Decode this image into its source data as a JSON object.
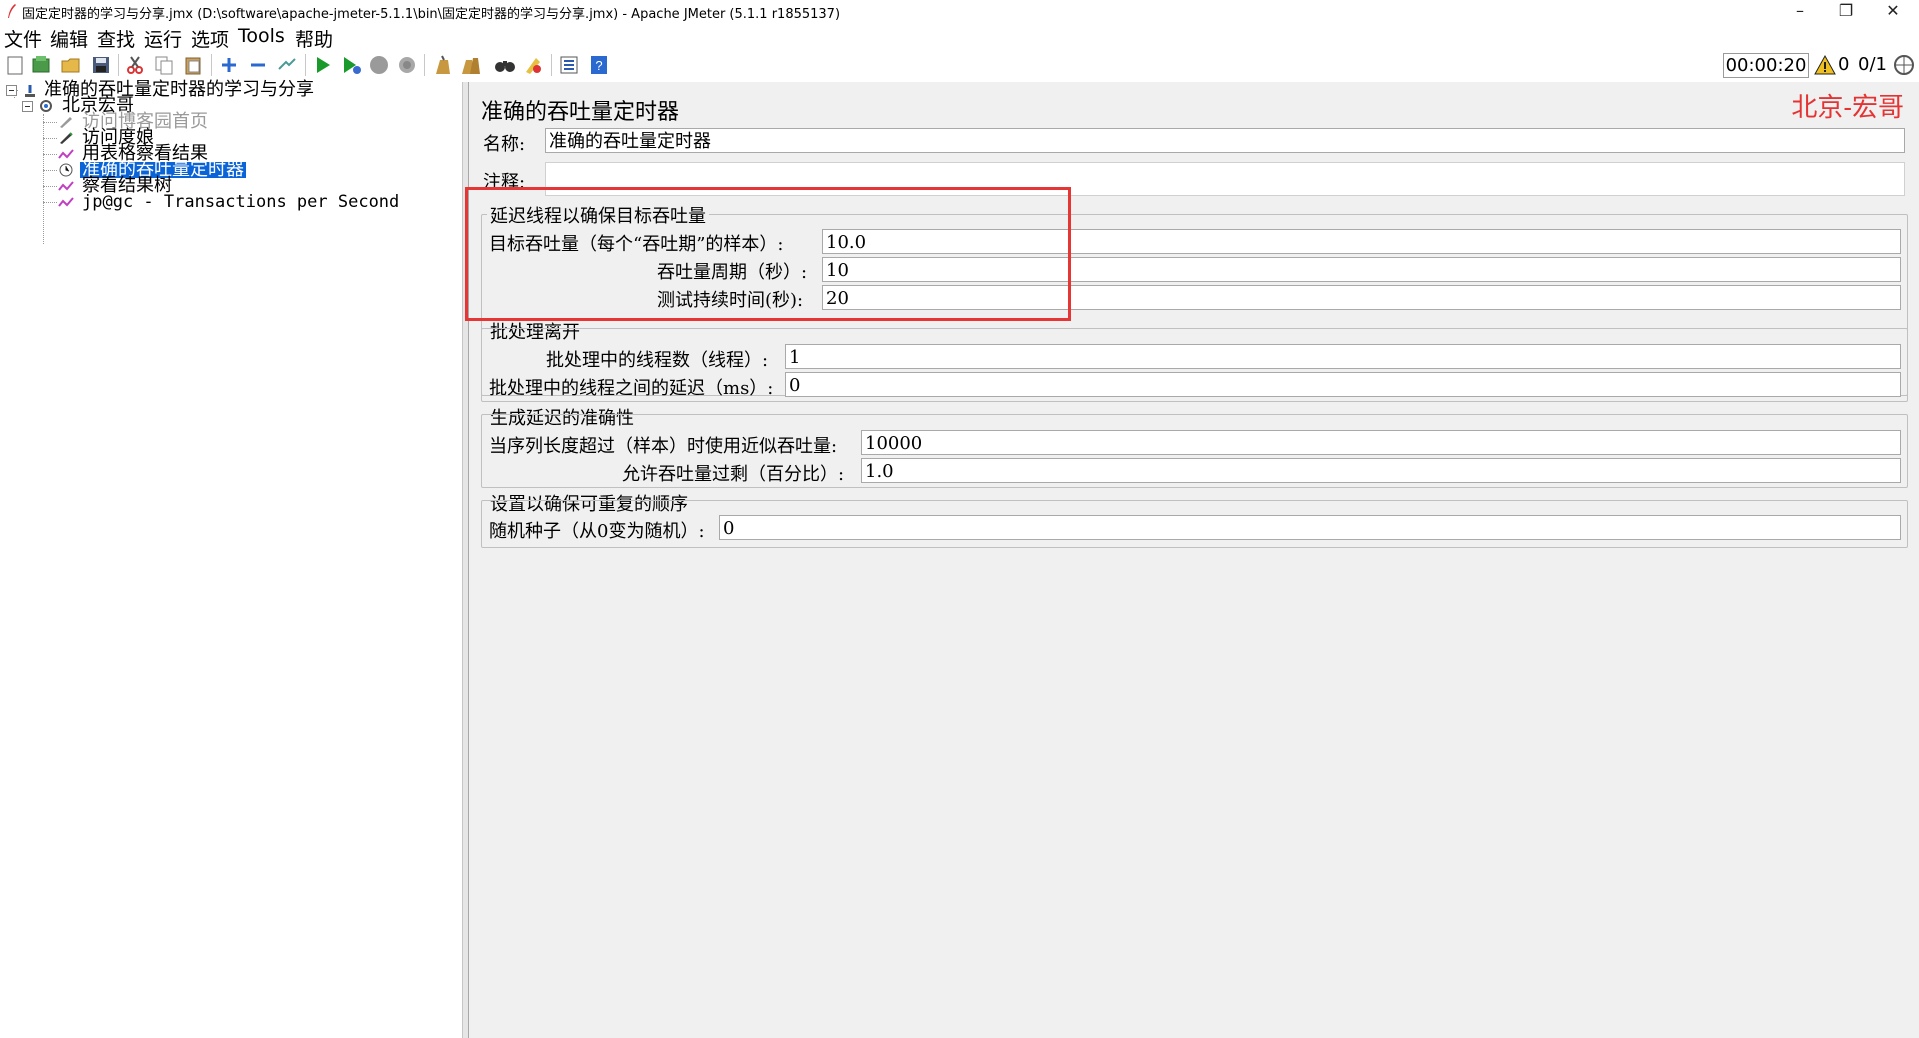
{
  "window": {
    "title": "固定定时器的学习与分享.jmx (D:\\software\\apache-jmeter-5.1.1\\bin\\固定定时器的学习与分享.jmx) - Apache JMeter (5.1.1 r1855137)",
    "minimize": "–",
    "maximize": "❐",
    "close": "✕"
  },
  "menu": {
    "file": "文件",
    "edit": "编辑",
    "search": "查找",
    "run": "运行",
    "options": "选项",
    "tools": "Tools",
    "help": "帮助"
  },
  "status": {
    "timer": "00:00:20",
    "warnings": "0",
    "threads": "0/1"
  },
  "tree": {
    "root": "准确的吞吐量定时器的学习与分享",
    "thread_group": "北京宏哥",
    "items": [
      {
        "label": "访问博客园首页",
        "icon": "sampler-icon",
        "disabled": true
      },
      {
        "label": "访问度娘",
        "icon": "sampler-icon",
        "disabled": false
      },
      {
        "label": "用表格察看结果",
        "icon": "listener-icon",
        "disabled": false
      },
      {
        "label": "准确的吞吐量定时器",
        "icon": "timer-icon",
        "disabled": false,
        "selected": true
      },
      {
        "label": "察看结果树",
        "icon": "listener-icon",
        "disabled": false
      },
      {
        "label": "jp@gc - Transactions per Second",
        "icon": "listener-icon",
        "disabled": false
      }
    ]
  },
  "panel": {
    "title": "准确的吞吐量定时器",
    "watermark": "北京-宏哥",
    "name_label": "名称:",
    "name_value": "准确的吞吐量定时器",
    "comment_label": "注释:",
    "comment_value": "",
    "delay_group": {
      "title": "延迟线程以确保目标吞吐量",
      "target_label": "目标吞吐量（每个“吞吐期”的样本）:",
      "target_value": "10.0",
      "period_label": "吞吐量周期（秒）:",
      "period_value": "10",
      "duration_label": "测试持续时间(秒):",
      "duration_value": "20"
    },
    "batch_group": {
      "title": "批处理离开",
      "threads_label": "批处理中的线程数（线程）:",
      "threads_value": "1",
      "delay_label": "批处理中的线程之间的延迟（ms）:",
      "delay_value": "0"
    },
    "accuracy_group": {
      "title": "生成延迟的准确性",
      "queue_label": "当序列长度超过（样本）时使用近似吞吐量:",
      "queue_value": "10000",
      "overshoot_label": "允许吞吐量过剩（百分比）:",
      "overshoot_value": "1.0"
    },
    "repeat_group": {
      "title": "设置以确保可重复的顺序",
      "seed_label": "随机种子（从0变为随机）:",
      "seed_value": "0"
    }
  },
  "colors": {
    "accent_red": "#e53535",
    "selection_blue": "#0a64d8",
    "panel_bg": "#f0f0f0"
  }
}
